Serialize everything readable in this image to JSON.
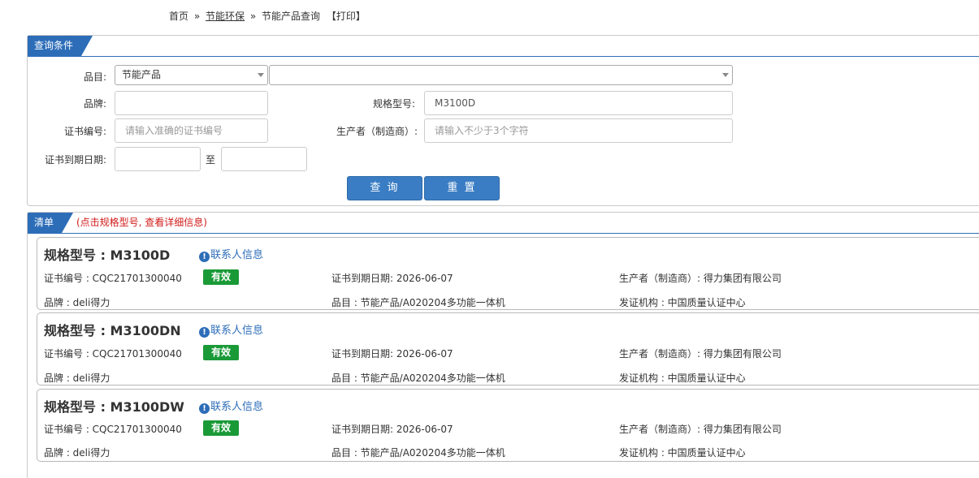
{
  "breadcrumb": {
    "home": "首页",
    "sep1": "»",
    "section": "节能环保",
    "sep2": "»",
    "current": "节能产品查询",
    "print": "【打印】"
  },
  "query": {
    "title": "查询条件",
    "category_label": "品目:",
    "category_value": "节能产品",
    "subcategory_value": "",
    "brand_label": "品牌:",
    "brand_value": "",
    "model_label": "规格型号:",
    "model_value": "M3100D",
    "cert_no_label": "证书编号:",
    "cert_no_placeholder": "请输入准确的证书编号",
    "producer_label": "生产者（制造商）:",
    "producer_placeholder": "请输入不少于3个字符",
    "expiry_label": "证书到期日期:",
    "expiry_from": "",
    "expiry_to_label": "至",
    "expiry_to": "",
    "search_button": "查 询",
    "reset_button": "重 置"
  },
  "list": {
    "title": "清单",
    "note": "(点击规格型号, 查看详细信息)",
    "contact_label": "联系人信息",
    "items": [
      {
        "model": "规格型号 : M3100D",
        "cert_no": "证书编号 : CQC21701300040",
        "status": "有效",
        "expiry": "证书到期日期: 2026-06-07",
        "producer": "生产者（制造商）: 得力集团有限公司",
        "brand": "品牌 : deli得力",
        "category": "品目 : 节能产品/A020204多功能一体机",
        "issuer": "发证机构 : 中国质量认证中心"
      },
      {
        "model": "规格型号 : M3100DN",
        "cert_no": "证书编号 : CQC21701300040",
        "status": "有效",
        "expiry": "证书到期日期: 2026-06-07",
        "producer": "生产者（制造商）: 得力集团有限公司",
        "brand": "品牌 : deli得力",
        "category": "品目 : 节能产品/A020204多功能一体机",
        "issuer": "发证机构 : 中国质量认证中心"
      },
      {
        "model": "规格型号 : M3100DW",
        "cert_no": "证书编号 : CQC21701300040",
        "status": "有效",
        "expiry": "证书到期日期: 2026-06-07",
        "producer": "生产者（制造商）: 得力集团有限公司",
        "brand": "品牌 : deli得力",
        "category": "品目 : 节能产品/A020204多功能一体机",
        "issuer": "发证机构 : 中国质量认证中心"
      }
    ]
  },
  "colors": {
    "accent": "#2d6db8",
    "button": "#3a7dc4",
    "valid_badge": "#1a9a37",
    "note": "#d11a1a"
  },
  "icons": {
    "info": "info-circle-icon",
    "dropdown": "chevron-down-icon"
  }
}
